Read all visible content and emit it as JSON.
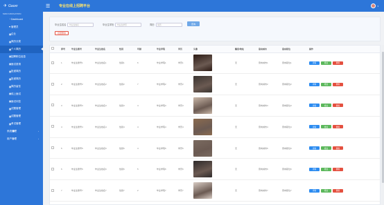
{
  "brand": {
    "logo_text": "Gaoxr",
    "section": "MAIN NAVIGATION"
  },
  "header": {
    "title": "专业在线上招聘平台"
  },
  "sidebar": {
    "items": [
      {
        "icon": "dashboard-icon",
        "label": "Dashboard"
      },
      {
        "icon": "heart-icon",
        "label": "管理员"
      },
      {
        "icon": "list-icon",
        "label": "企业"
      },
      {
        "icon": "list-icon",
        "label": "简历分类"
      },
      {
        "icon": "list-icon",
        "label": "个人简历",
        "active": true
      },
      {
        "icon": "list-icon",
        "label": "招聘职位信息"
      },
      {
        "icon": "list-icon",
        "label": "面试邀请"
      },
      {
        "icon": "list-icon",
        "label": "投递简历"
      },
      {
        "icon": "list-icon",
        "label": "投递简历"
      },
      {
        "icon": "list-icon",
        "label": "简历留言"
      },
      {
        "icon": "list-icon",
        "label": "线上面试"
      },
      {
        "icon": "list-icon",
        "label": "面试问答"
      },
      {
        "icon": "list-icon",
        "label": "试题管理"
      },
      {
        "icon": "list-icon",
        "label": "试题管理"
      },
      {
        "icon": "list-icon",
        "label": "考试管理"
      },
      {
        "icon": "list-icon",
        "label": "系统管理",
        "group": true
      },
      {
        "icon": "user-icon",
        "label": "用户管理",
        "group": true
      }
    ]
  },
  "search": {
    "fields": [
      {
        "label": "毕业生姓名",
        "placeholder": "毕业生姓名"
      },
      {
        "label": "毕业生学历",
        "placeholder": "毕业生学历"
      },
      {
        "label": "简历",
        "placeholder": "简历"
      }
    ],
    "search_label": "查询",
    "delete_label": "批量删除"
  },
  "table": {
    "columns": [
      "",
      "序号",
      "毕业生账号",
      "毕业生姓名",
      "性别",
      "年龄",
      "毕业学院",
      "学历",
      "头像",
      "籍贯/地址",
      "意向城市",
      "意向职位",
      "操作"
    ],
    "rows": [
      {
        "no": "1",
        "account": "毕业生账号1",
        "name": "毕业生姓名1",
        "gender": "性别1",
        "age": "6",
        "school": "毕业学院1",
        "degree": "学历1",
        "photo_color": "#2b1a14",
        "origin": "无",
        "city": "意向城市1",
        "job": "意向职位1"
      },
      {
        "no": "2",
        "account": "毕业生账号2",
        "name": "毕业生姓名2",
        "gender": "性别2",
        "age": "7",
        "school": "毕业学院2",
        "degree": "学历2",
        "photo_color": "#3a3430",
        "origin": "无",
        "city": "意向城市2",
        "job": "意向职位2"
      },
      {
        "no": "3",
        "account": "毕业生账号3",
        "name": "毕业生姓名3",
        "gender": "性别3",
        "age": "4",
        "school": "毕业学院3",
        "degree": "学历3",
        "photo_color": "#c9b7a8",
        "origin": "无",
        "city": "意向城市3",
        "job": "意向职位3"
      },
      {
        "no": "4",
        "account": "毕业生账号4",
        "name": "毕业生姓名4",
        "gender": "性别4",
        "age": "4",
        "school": "毕业学院4",
        "degree": "学历4",
        "photo_color": "#8b6b4f",
        "origin": "无",
        "city": "意向城市4",
        "job": "意向职位4"
      },
      {
        "no": "5",
        "account": "毕业生账号5",
        "name": "毕业生姓名5",
        "gender": "性别5",
        "age": "4",
        "school": "毕业学院5",
        "degree": "学历5",
        "photo_color": "#7a6a60",
        "origin": "无",
        "city": "意向城市5",
        "job": "意向职位5"
      },
      {
        "no": "6",
        "account": "毕业生账号6",
        "name": "毕业生姓名6",
        "gender": "性别6",
        "age": "5",
        "school": "毕业学院6",
        "degree": "学历6",
        "photo_color": "#2e2a2a",
        "origin": "无",
        "city": "意向城市6",
        "job": "意向职位6"
      },
      {
        "no": "7",
        "account": "毕业生账号7",
        "name": "毕业生姓名7",
        "gender": "性别7",
        "age": "2",
        "school": "毕业学院7",
        "degree": "学历7",
        "photo_color": "#d8ccc4",
        "origin": "无",
        "city": "意向城市7",
        "job": "意向职位7"
      }
    ],
    "actions": {
      "detail": "详情",
      "edit": "修改",
      "delete": "删除"
    }
  },
  "colors": {
    "primary": "#2d76d9",
    "accent_title": "#ffe56b",
    "danger": "#e4503f",
    "success": "#5cb85c",
    "info": "#2d8cf0"
  }
}
